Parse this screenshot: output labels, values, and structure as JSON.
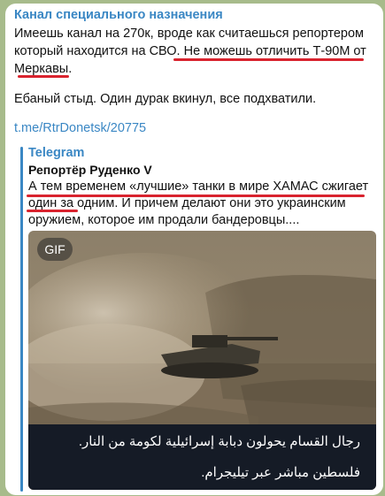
{
  "post": {
    "channel_name": "Канал специального назначения",
    "text_part1": "Имеешь канал на 270к, вроде как считаешься репортером который находится на СВО. ",
    "text_highlight": "Не можешь отличить Т-90М от Меркавы",
    "text_part2": ".",
    "paragraph2": "Ебаный стыд. Один дурак вкинул, все подхватили.",
    "link": "t.me/RtrDonetsk/20775",
    "accent_color": "#3a87c4",
    "underline_color": "#d9232e"
  },
  "forwarded": {
    "source": "Telegram",
    "author": "Репортёр Руденко V",
    "text_highlight": "А тем временем «лучшие» танки в мире ХАМАС сжигает один за одним",
    "text_rest": ". И причем делают они это украинским оружием, которое им продали бандеровцы....",
    "media": {
      "badge": "GIF",
      "caption_line1": "رجال القسام يحولون دبابة إسرائيلية لكومة من النار.",
      "caption_line2": "فلسطين مباشر عبر تيليجرام."
    }
  }
}
